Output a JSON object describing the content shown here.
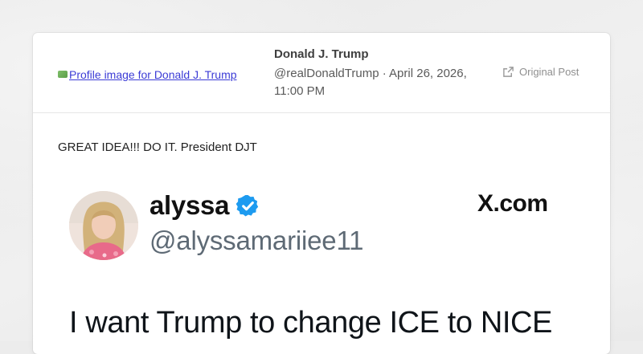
{
  "post": {
    "avatar_alt": "Profile image for Donald J. Trump",
    "author_name": "Donald J. Trump",
    "author_meta": "@realDonaldTrump · April 26, 2026, 11:00 PM",
    "original_post_label": "Original Post",
    "text": "GREAT IDEA!!! DO IT. President DJT"
  },
  "embed": {
    "name": "alyssa",
    "handle": "@alyssamariiee11",
    "source": "X.com",
    "text": "I want Trump to change ICE to NICE",
    "colors": {
      "verified": "#1d9bf0",
      "handle": "#5e6a75"
    }
  },
  "icons": {
    "original_post": "external-link-icon",
    "verified": "verified-badge-icon"
  }
}
